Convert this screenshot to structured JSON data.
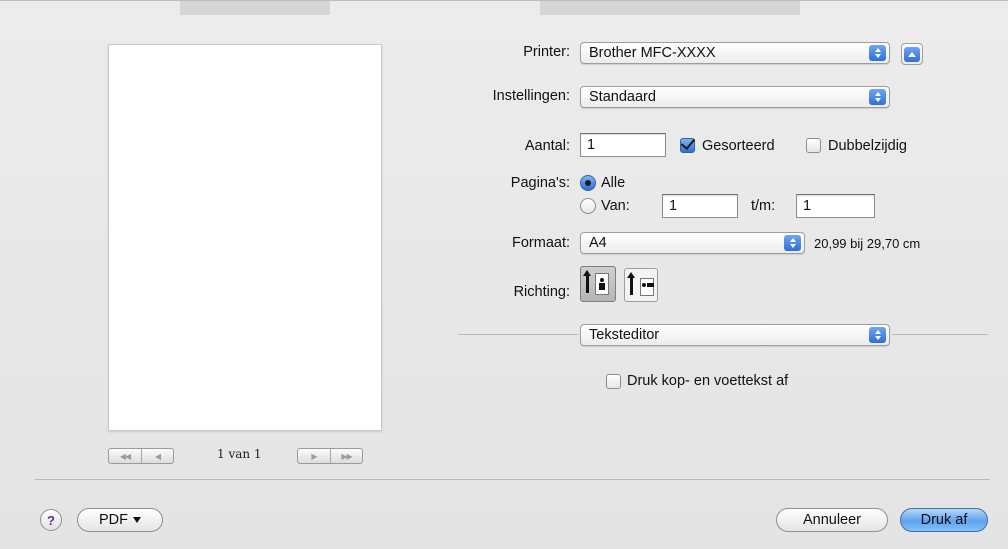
{
  "preview": {
    "page_label": "1 van 1"
  },
  "printer": {
    "label": "Printer:",
    "value": "Brother MFC-XXXX"
  },
  "settings": {
    "label": "Instellingen:",
    "value": "Standaard"
  },
  "copies": {
    "label": "Aantal:",
    "value": "1",
    "collated_label": "Gesorteerd",
    "collated": true,
    "duplex_label": "Dubbelzijdig",
    "duplex": false
  },
  "pages": {
    "label": "Pagina's:",
    "all_label": "Alle",
    "range_label": "Van:",
    "from": "1",
    "to_label": "t/m:",
    "to": "1",
    "selected": "all"
  },
  "paper": {
    "label": "Formaat:",
    "value": "A4",
    "dimensions": "20,99 bij 29,70 cm"
  },
  "orientation": {
    "label": "Richting:",
    "selected": "portrait"
  },
  "panel": {
    "value": "Teksteditor",
    "header_footer_label": "Druk kop- en voettekst af",
    "header_footer": false
  },
  "buttons": {
    "help": "?",
    "pdf": "PDF",
    "cancel": "Annuleer",
    "print": "Druk af"
  },
  "colors": {
    "accent": "#2f6fd6",
    "default_button": "#5ea2ee",
    "background": "#e9e9ea"
  }
}
